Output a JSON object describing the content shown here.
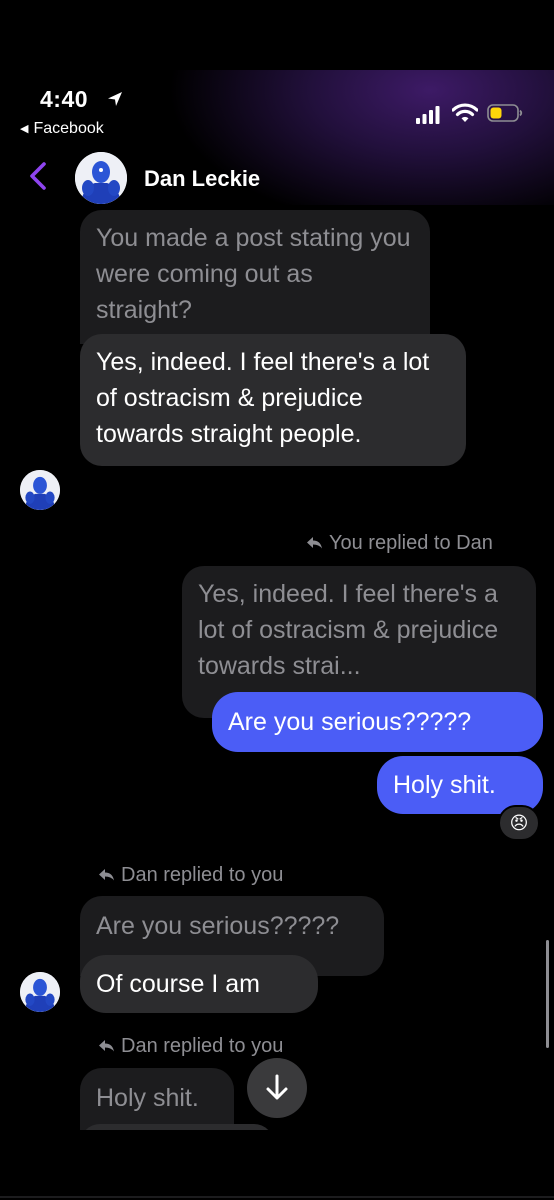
{
  "status_bar": {
    "time": "4:40",
    "back_app": "Facebook",
    "battery_color": "#ffd60a"
  },
  "header": {
    "contact_name": "Dan Leckie",
    "accent_color": "#8e44ef",
    "avatar_icon": "blue-figure-avatar"
  },
  "messages": [
    {
      "kind": "quoted",
      "text": "You made a post stating you were coming out as straight?"
    },
    {
      "kind": "incoming",
      "text": "Yes, indeed. I feel there's a lot of ostracism & prejudice towards straight people."
    },
    {
      "kind": "reply-note",
      "text": "You replied to Dan"
    },
    {
      "kind": "quoted",
      "text": "Yes, indeed. I feel there's a lot of ostracism & prejudice towards strai..."
    },
    {
      "kind": "outgoing",
      "text": "Are you serious?????"
    },
    {
      "kind": "outgoing",
      "text": "Holy shit.",
      "reaction": "😠"
    },
    {
      "kind": "reply-note",
      "text": "Dan replied to you"
    },
    {
      "kind": "quoted",
      "text": "Are you serious?????"
    },
    {
      "kind": "incoming",
      "text": "Of course I am"
    },
    {
      "kind": "reply-note",
      "text": "Dan replied to you"
    },
    {
      "kind": "quoted",
      "text": "Holy shit."
    }
  ],
  "colors": {
    "outgoing_bubble": "#4b5df6",
    "incoming_bubble": "#2c2c2e",
    "quoted_bubble": "#1c1c1e"
  }
}
